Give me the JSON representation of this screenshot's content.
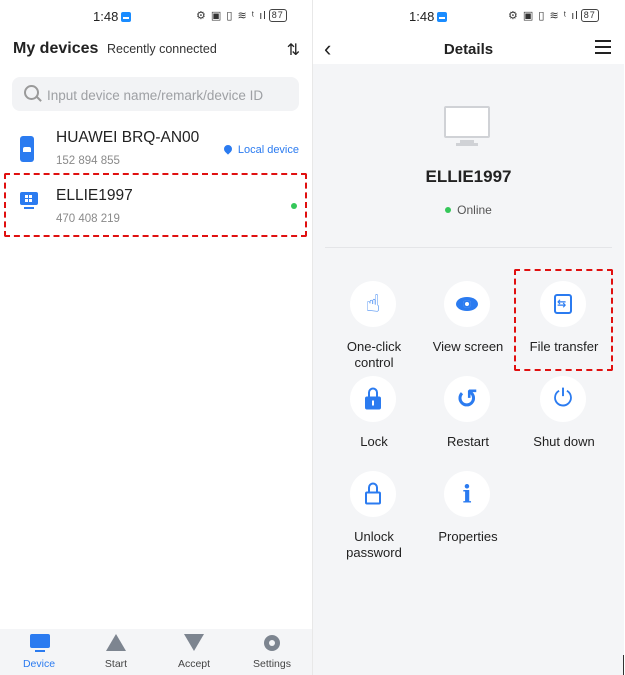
{
  "status_bar": {
    "time": "1:48",
    "icons": "⚙ ▣ ▯ ≋ ᵗ ıl",
    "battery": "87"
  },
  "left": {
    "title": "My devices",
    "tab_label": "Recently connected",
    "sort_icon": "sort-icon",
    "search_placeholder": "Input device name/remark/device ID",
    "devices": [
      {
        "name": "HUAWEI BRQ-AN00",
        "id": "152 894 855",
        "tag": "Local device",
        "icon": "phone-icon"
      },
      {
        "name": "ELLIE1997",
        "id": "470 408 219",
        "status": "online",
        "icon": "computer-icon"
      }
    ],
    "nav": [
      {
        "label": "Device",
        "icon": "device-icon",
        "active": true
      },
      {
        "label": "Start",
        "icon": "start-icon"
      },
      {
        "label": "Accept",
        "icon": "accept-icon"
      },
      {
        "label": "Settings",
        "icon": "gear-icon"
      }
    ]
  },
  "right": {
    "title": "Details",
    "device_name": "ELLIE1997",
    "status": "Online",
    "actions": [
      {
        "label": "One-click control",
        "icon": "pointer-hand-icon"
      },
      {
        "label": "View screen",
        "icon": "eye-icon"
      },
      {
        "label": "File transfer",
        "icon": "file-transfer-icon"
      },
      {
        "label": "Lock",
        "icon": "lock-icon"
      },
      {
        "label": "Restart",
        "icon": "restart-icon"
      },
      {
        "label": "Shut down",
        "icon": "power-icon"
      },
      {
        "label": "Unlock password",
        "icon": "unlock-icon"
      },
      {
        "label": "Properties",
        "icon": "info-icon"
      }
    ]
  },
  "colors": {
    "accent": "#2b7bf0",
    "online": "#34c759",
    "highlight": "#e01010"
  }
}
